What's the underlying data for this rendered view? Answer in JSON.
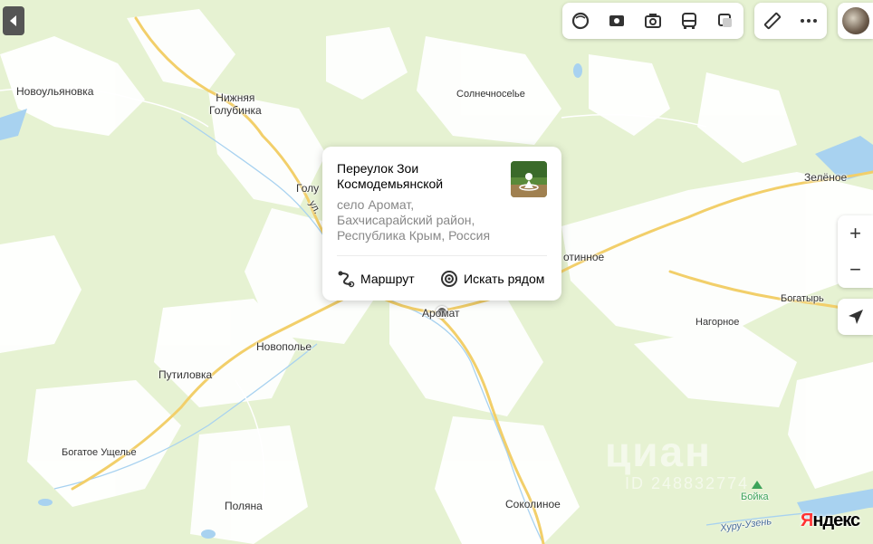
{
  "map": {
    "places": [
      {
        "id": "novoulyanovka",
        "label": "Новоульяновка"
      },
      {
        "id": "nizhnyaya",
        "label": "Нижняя\nГолубинка"
      },
      {
        "id": "solnechnoselye",
        "label": "Солнечносelье"
      },
      {
        "id": "zelenoe",
        "label": "Зелёное"
      },
      {
        "id": "goluba",
        "label": "Голу"
      },
      {
        "id": "street",
        "label": "ул."
      },
      {
        "id": "kotinnoe",
        "label": "отинное"
      },
      {
        "id": "aromat",
        "label": "Аромат"
      },
      {
        "id": "bogatyr",
        "label": "Богатырь"
      },
      {
        "id": "nagornoe",
        "label": "Нагорное"
      },
      {
        "id": "novopole",
        "label": "Новополье"
      },
      {
        "id": "putilovka",
        "label": "Путиловка"
      },
      {
        "id": "bogatoe",
        "label": "Богатое Ущелье"
      },
      {
        "id": "polyana",
        "label": "Поляна"
      },
      {
        "id": "sokolinoe",
        "label": "Соколиное"
      },
      {
        "id": "boyka",
        "label": "Бойка"
      },
      {
        "id": "khuru",
        "label": "Хуру-Узень"
      }
    ]
  },
  "popup": {
    "title": "Переулок Зои Космодемьянской",
    "address": "село Аромат, Бахчисарайский район, Республика Крым, Россия",
    "route_label": "Маршрут",
    "nearby_label": "Искать рядом"
  },
  "controls": {
    "layers": [
      "layers-icon",
      "panorama-icon",
      "photo-icon",
      "transport-icon",
      "traffic-icon"
    ],
    "tools": [
      "ruler-icon",
      "more-icon"
    ],
    "zoom_in": "+",
    "zoom_out": "−"
  },
  "brand": {
    "logo_y": "Я",
    "logo_rest": "ндекс"
  },
  "watermark": {
    "text": "циан",
    "id": "ID 248832774"
  },
  "colors": {
    "forest": "#e6f2d2",
    "clearing": "#ffffff",
    "road": "#f2cf6a",
    "water": "#a8d2f0",
    "accent": "#ff3333"
  }
}
